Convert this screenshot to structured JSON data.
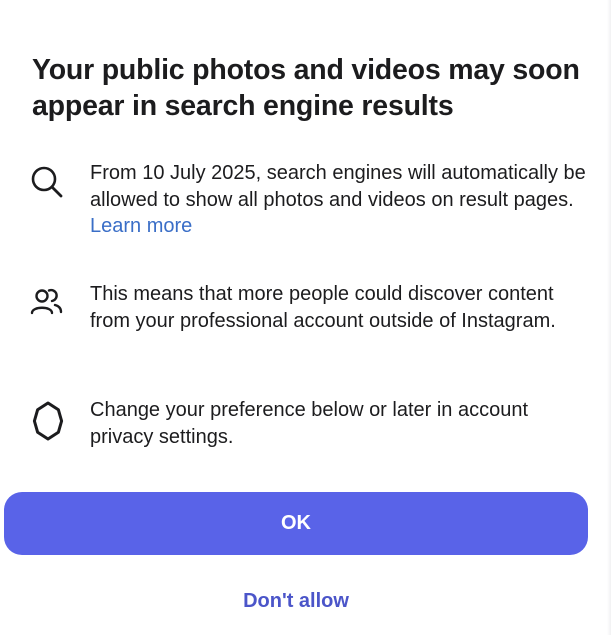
{
  "dialog": {
    "title": "Your public photos and videos may soon appear in search engine results",
    "items": [
      {
        "icon": "search-icon",
        "text": "From 10 July 2025, search engines will automatically be allowed to show all photos and videos on result pages.",
        "link": "Learn more"
      },
      {
        "icon": "people-icon",
        "text": "This means that more people could discover content from your professional account outside of Instagram."
      },
      {
        "icon": "gear-icon",
        "text": "Change your preference below or later in account privacy settings."
      }
    ],
    "ok_label": "OK",
    "dont_allow_label": "Don't allow"
  },
  "colors": {
    "primary_button": "#5963e8",
    "secondary_text": "#4b55c9",
    "link": "#3a6ec7"
  }
}
